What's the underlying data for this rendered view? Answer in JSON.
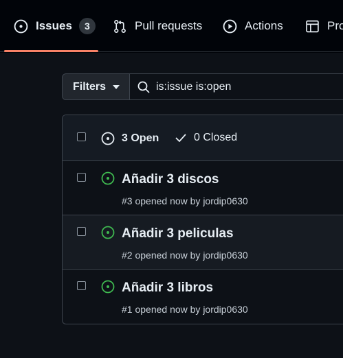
{
  "nav": {
    "tabs": [
      {
        "label": "Issues",
        "count": "3",
        "icon": "issue-opened-icon",
        "selected": true
      },
      {
        "label": "Pull requests",
        "icon": "git-pull-request-icon"
      },
      {
        "label": "Actions",
        "icon": "play-icon"
      },
      {
        "label": "Pro",
        "icon": "table-icon"
      }
    ]
  },
  "filters": {
    "label": "Filters",
    "search_value": "is:issue is:open"
  },
  "issues_header": {
    "open_label": "3 Open",
    "closed_label": "0 Closed"
  },
  "issues": [
    {
      "title": "Añadir 3 discos",
      "meta": "#3 opened now by jordip0630"
    },
    {
      "title": "Añadir 3 peliculas",
      "meta": "#2 opened now by jordip0630"
    },
    {
      "title": "Añadir 3 libros",
      "meta": "#1 opened now by jordip0630"
    }
  ],
  "colors": {
    "accent_underline": "#f78166",
    "open_green": "#3fb950",
    "background": "#0d1117"
  }
}
